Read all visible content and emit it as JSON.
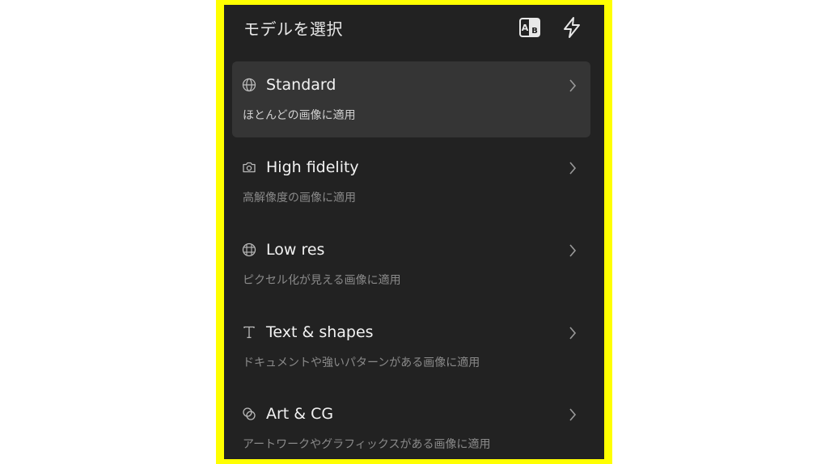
{
  "header": {
    "title": "モデルを選択",
    "translate_icon": "translate-icon",
    "flash_icon": "lightning-icon"
  },
  "models": [
    {
      "title": "Standard",
      "description": "ほとんどの画像に適用",
      "icon": "globe-icon",
      "selected": true
    },
    {
      "title": "High fidelity",
      "description": "高解像度の画像に適用",
      "icon": "camera-icon",
      "selected": false
    },
    {
      "title": "Low res",
      "description": "ピクセル化が見える画像に適用",
      "icon": "grid-globe-icon",
      "selected": false
    },
    {
      "title": "Text & shapes",
      "description": "ドキュメントや強いパターンがある画像に適用",
      "icon": "text-icon",
      "selected": false
    },
    {
      "title": "Art & CG",
      "description": "アートワークやグラフィックスがある画像に適用",
      "icon": "art-icon",
      "selected": false
    }
  ],
  "colors": {
    "frame": "#ffff00",
    "panel": "#222222",
    "selected_row": "#353535"
  }
}
